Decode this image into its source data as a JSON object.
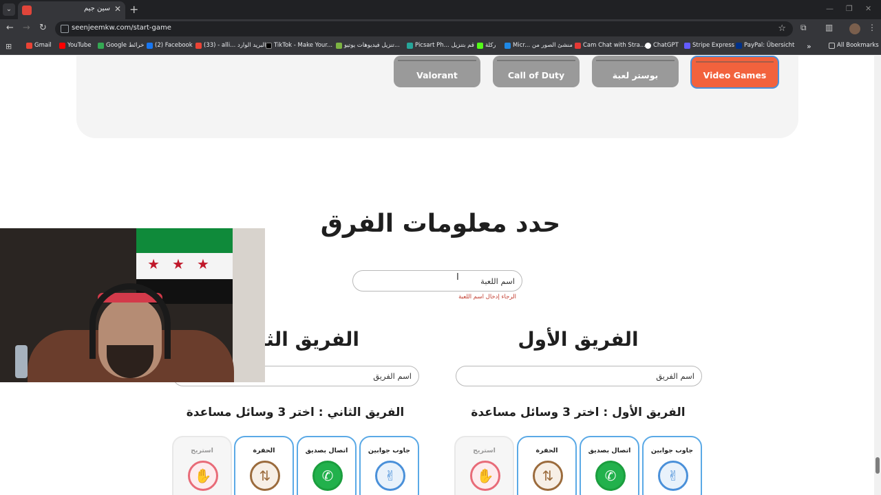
{
  "browser": {
    "tab_title": "سين جيم",
    "url": "seenjeemkw.com/start-game",
    "bookmarks": [
      {
        "label": "Gmail",
        "color": "#ea4335"
      },
      {
        "label": "YouTube",
        "color": "#ff0000"
      },
      {
        "label": "Google خرائط",
        "color": "#34a853"
      },
      {
        "label": "(2) Facebook",
        "color": "#1877f2"
      },
      {
        "label": "(33) - alli... البريد الوارد",
        "color": "#ea4335"
      },
      {
        "label": "TikTok - Make Your...",
        "color": "#000000"
      },
      {
        "label": "تنزيل فيديوهات يوتيو...",
        "color": "#7cb342"
      },
      {
        "label": "Picsart Ph... قم بتنزيل",
        "color": "#26a69a"
      },
      {
        "label": "ركلة",
        "color": "#53fc18"
      },
      {
        "label": "Micr... منشئ الصور من",
        "color": "#1e88e5"
      },
      {
        "label": "Cam Chat with Stra...",
        "color": "#e53935"
      },
      {
        "label": "ChatGPT",
        "color": "#ffffff"
      },
      {
        "label": "Stripe Express",
        "color": "#635bff"
      },
      {
        "label": "PayPal: Übersicht",
        "color": "#003087"
      }
    ],
    "all_bookmarks": "All Bookmarks"
  },
  "categories": [
    {
      "label": "Valorant",
      "active": false
    },
    {
      "label": "Call of Duty",
      "active": false
    },
    {
      "label": "بوستر لعبة",
      "active": false
    },
    {
      "label": "Video Games",
      "active": true
    }
  ],
  "setup": {
    "heading": "حدد معلومات الفرق",
    "game_name_placeholder": "اسم اللعبة",
    "game_name_error": "الرجاء إدخال اسم اللعبة"
  },
  "teams": [
    {
      "title": "الفريق الأول",
      "name_placeholder": "اسم الفريق",
      "aids_title": "الفريق الأول : اختر 3 وسائل مساعدة",
      "aids": [
        {
          "label": "جاوب جوابين",
          "icon": "peace-hand-icon",
          "color": "blue",
          "enabled": true
        },
        {
          "label": "اتصال بصديق",
          "icon": "phone-icon",
          "color": "green",
          "enabled": true
        },
        {
          "label": "الحفرة",
          "icon": "swap-arrows-icon",
          "color": "brown",
          "enabled": true
        },
        {
          "label": "استريح",
          "icon": "stop-hand-icon",
          "color": "red",
          "enabled": false
        }
      ]
    },
    {
      "title": "الفريق الثاني",
      "name_placeholder": "اسم الفريق",
      "aids_title": "الفريق الثاني : اختر 3 وسائل مساعدة",
      "aids": [
        {
          "label": "جاوب جوابين",
          "icon": "peace-hand-icon",
          "color": "blue",
          "enabled": true
        },
        {
          "label": "اتصال بصديق",
          "icon": "phone-icon",
          "color": "green",
          "enabled": true
        },
        {
          "label": "الحفرة",
          "icon": "swap-arrows-icon",
          "color": "brown",
          "enabled": true
        },
        {
          "label": "استريح",
          "icon": "stop-hand-icon",
          "color": "red",
          "enabled": false
        }
      ]
    }
  ],
  "colors": {
    "accent_active": "#f2623d",
    "card_border": "#5aa9e6",
    "error": "#c0392b"
  }
}
